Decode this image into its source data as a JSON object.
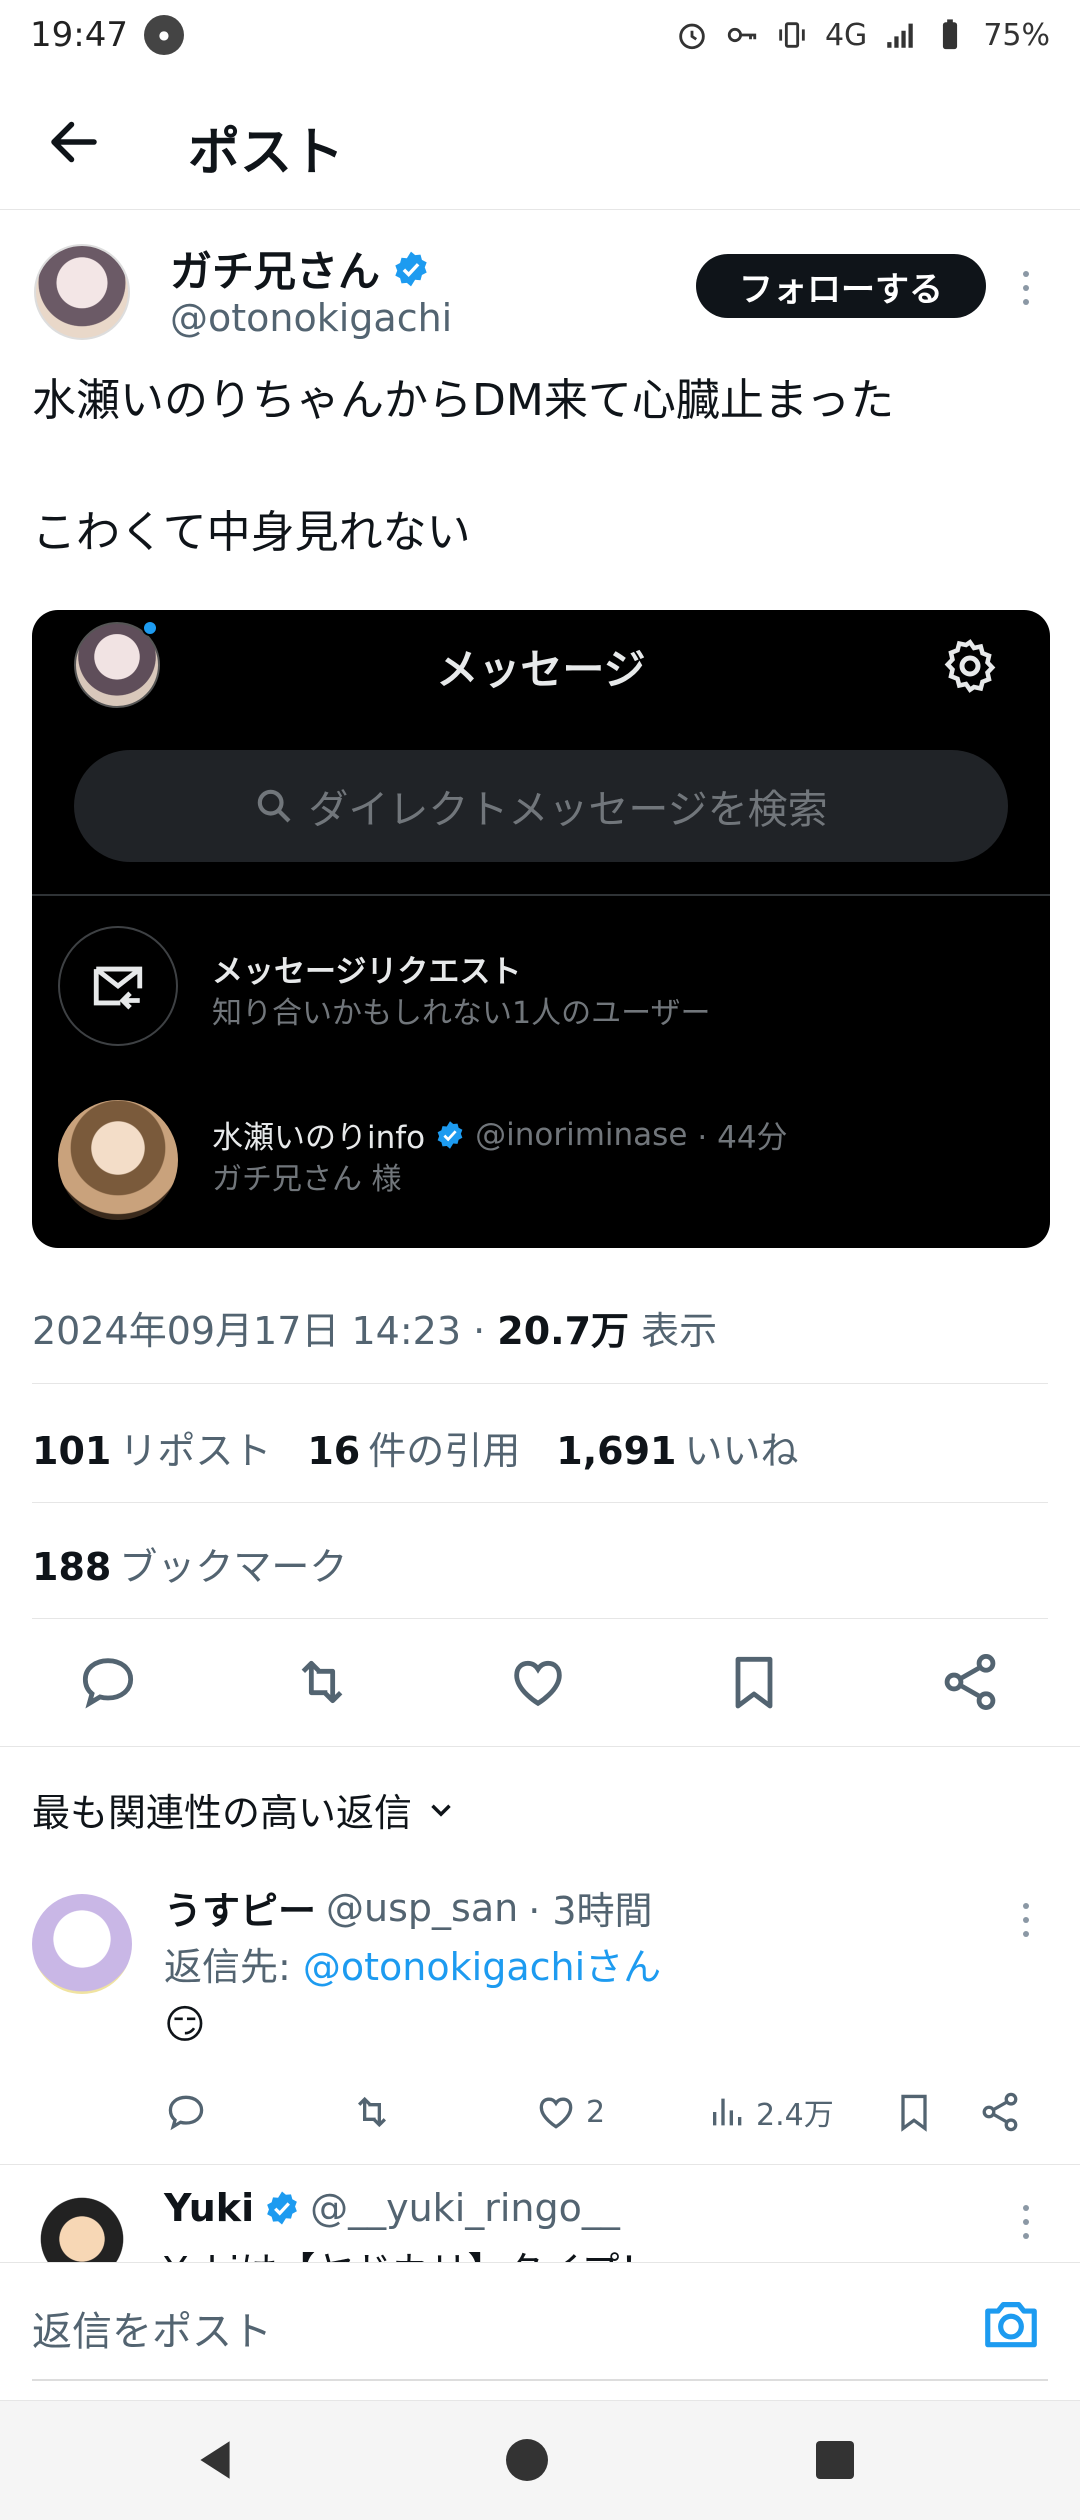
{
  "status_bar": {
    "time": "19:47",
    "battery": "75%",
    "network": "4G"
  },
  "app_bar": {
    "title": "ポスト"
  },
  "post": {
    "author_name": "ガチ兄さん",
    "author_handle": "@otonokigachi",
    "follow_label": "フォローする",
    "text_line1": "水瀬いのりちゃんからDM来て心臓止まった",
    "text_line2": "こわくて中身見れない",
    "timestamp": "2024年09月17日 14:23",
    "views_count": "20.7万",
    "views_label": "表示",
    "reposts_count": "101",
    "reposts_label": "リポスト",
    "quotes_count": "16",
    "quotes_label": "件の引用",
    "likes_count": "1,691",
    "likes_label": "いいね",
    "bookmarks_count": "188",
    "bookmarks_label": "ブックマーク"
  },
  "embedded_image": {
    "title": "メッセージ",
    "search_placeholder": "ダイレクトメッセージを検索",
    "request_title": "メッセージリクエスト",
    "request_subtitle": "知り合いかもしれない1人のユーザー",
    "conversation_name": "水瀬いのりinfo",
    "conversation_handle": "@inoriminase",
    "conversation_time": "· 44分",
    "conversation_preview": "ガチ兄さん 様"
  },
  "replies_sort": {
    "label": "最も関連性の高い返信"
  },
  "replies": [
    {
      "name": "うすピー",
      "handle": "@usp_san",
      "time": "· 3時間",
      "reply_to_prefix": "返信先:",
      "reply_to_link": "@otonokigachiさん",
      "emoji": "😏",
      "likes": "2",
      "views": "2.4万"
    },
    {
      "name": "Yuki",
      "handle": "@__yuki_ringo__",
      "snippet": "Yukiは【ヤドカリ】タイプ！"
    }
  ],
  "compose": {
    "placeholder": "返信をポスト"
  },
  "colors": {
    "accent": "#1d9bf0",
    "text": "#0f1419",
    "muted": "#536471",
    "dark_card": "#000000"
  }
}
